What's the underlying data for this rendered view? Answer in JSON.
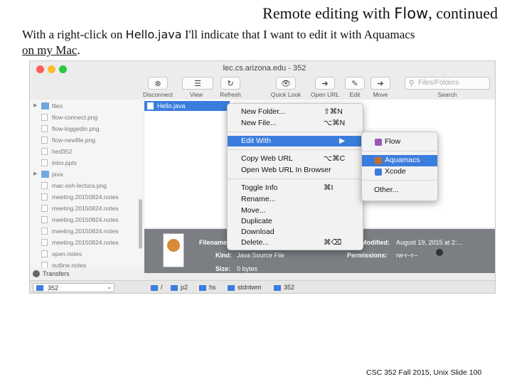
{
  "slide": {
    "title_prefix": "Remote editing with ",
    "title_flow": "Flow",
    "title_suffix": ", continued",
    "text_part1": "With a right-click on ",
    "text_file": "Hello.java",
    "text_part2": " I'll indicate that I want to edit it with Aquamacs ",
    "text_link": "on my Mac",
    "text_end": ".",
    "footer": "CSC 352 Fall 2015, Unix Slide 100"
  },
  "window": {
    "title": "lec.cs.arizona.edu - 352",
    "toolbar": [
      {
        "label": "Disconnect",
        "glyph": "⊗"
      },
      {
        "label": "View",
        "glyph": "☰"
      },
      {
        "label": "Refresh",
        "glyph": "↻"
      },
      {
        "label": "Quick Look",
        "glyph": "👁"
      },
      {
        "label": "Open URL",
        "glyph": "➜"
      },
      {
        "label": "Edit",
        "glyph": "✎"
      },
      {
        "label": "Move",
        "glyph": "➔"
      },
      {
        "label": "Search",
        "glyph": ""
      }
    ],
    "search_placeholder": "Files/Folders"
  },
  "sidebar": {
    "items": [
      {
        "name": "files",
        "type": "folder",
        "expandable": true
      },
      {
        "name": "flow-connect.png",
        "type": "file"
      },
      {
        "name": "flow-loggedin.png",
        "type": "file"
      },
      {
        "name": "flow-newfile.png",
        "type": "file"
      },
      {
        "name": "hed352",
        "type": "file"
      },
      {
        "name": "intro.pptx",
        "type": "file"
      },
      {
        "name": "java",
        "type": "folder",
        "expandable": true
      },
      {
        "name": "mac-ssh-lectura.png",
        "type": "file"
      },
      {
        "name": "meeting.20150824.notes",
        "type": "file"
      },
      {
        "name": "meeting.20150824.notes",
        "type": "file"
      },
      {
        "name": "meeting.20150824.notes",
        "type": "file"
      },
      {
        "name": "meeting.20150824.notes",
        "type": "file"
      },
      {
        "name": "meeting.20150824.notes",
        "type": "file"
      },
      {
        "name": "open.notes",
        "type": "file"
      },
      {
        "name": "outline.notes",
        "type": "file"
      }
    ],
    "transfers_label": "Transfers"
  },
  "selected_file": "Hello.java",
  "context_menu": {
    "items": [
      {
        "label": "New Folder...",
        "shortcut": "⇧⌘N"
      },
      {
        "label": "New File...",
        "shortcut": "⌥⌘N"
      },
      {
        "label": "Edit With",
        "shortcut": "▶",
        "highlighted": true
      },
      {
        "label": "Copy Web URL",
        "shortcut": "⌥⌘C"
      },
      {
        "label": "Open Web URL In Browser",
        "shortcut": ""
      },
      {
        "label": "Toggle Info",
        "shortcut": "⌘I"
      },
      {
        "label": "Rename...",
        "shortcut": ""
      },
      {
        "label": "Move...",
        "shortcut": ""
      },
      {
        "label": "Duplicate",
        "shortcut": ""
      },
      {
        "label": "Download",
        "shortcut": ""
      },
      {
        "label": "Delete...",
        "shortcut": "⌘⌫"
      }
    ]
  },
  "submenu": {
    "items": [
      {
        "label": "Flow",
        "icon": "flow-app-icon",
        "color": "#9b59b6"
      },
      {
        "label": "Aquamacs",
        "icon": "aquamacs-app-icon",
        "color": "#c0722d",
        "highlighted": true
      },
      {
        "label": "Xcode",
        "icon": "xcode-app-icon",
        "color": "#3b7ddd"
      },
      {
        "label": "Other...",
        "icon": ""
      }
    ]
  },
  "info_panel": {
    "filename_label": "Filename:",
    "modified_label": "Modified:",
    "modified_value": "August 19, 2015 at 2:...",
    "kind_label": "Kind:",
    "kind_value": "Java Source File",
    "permissions_label": "Permissions:",
    "permissions_value": "rw-r--r--",
    "size_label": "Size:",
    "size_value": "0 bytes"
  },
  "pathbar": {
    "selector": "352",
    "crumbs": [
      "/",
      "p2",
      "hs",
      "stdntwm",
      "352"
    ]
  },
  "colors": {
    "selection": "#3b7ddd",
    "info_panel_bg": "#7b7f84"
  }
}
